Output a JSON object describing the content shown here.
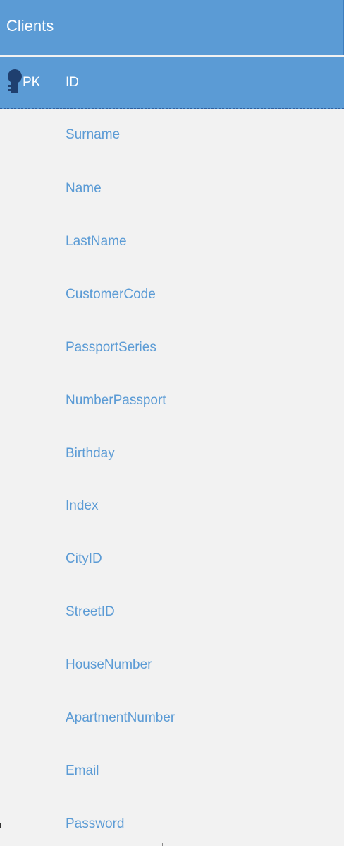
{
  "entity": {
    "title": "Clients",
    "primary_key": {
      "badge": "PK",
      "field": "ID"
    },
    "fields": [
      "Surname",
      "Name",
      "LastName",
      "CustomerCode",
      "PassportSeries",
      "NumberPassport",
      "Birthday",
      "Index",
      "CityID",
      "StreetID",
      "HouseNumber",
      "ApartmentNumber",
      "Email",
      "Password"
    ]
  },
  "colors": {
    "header_bg": "#5b9bd5",
    "body_bg": "#f2f2f2",
    "field_text": "#5b9bd5",
    "header_text": "#ffffff",
    "key_icon": "#1f3f6f"
  },
  "icons": {
    "primary_key": "key-icon"
  }
}
